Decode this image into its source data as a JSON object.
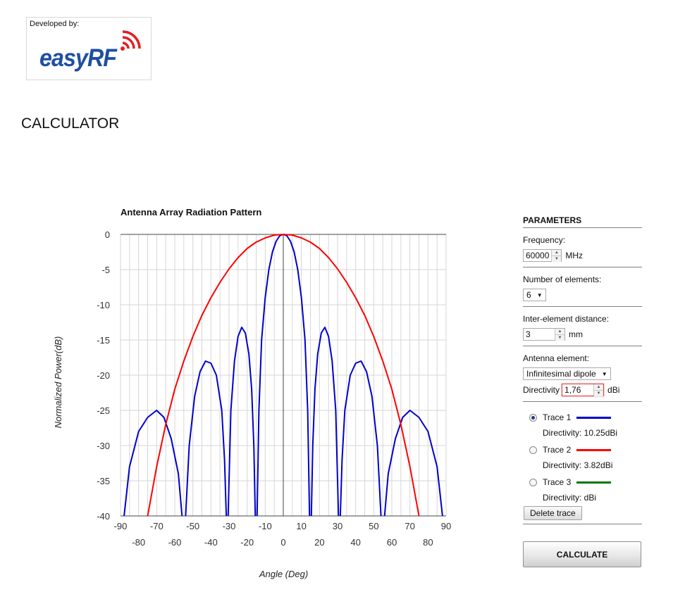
{
  "logo": {
    "developed_by": "Developed by:",
    "brand_easy": "easy",
    "brand_rf": "RF"
  },
  "page_title": "CALCULATOR",
  "chart_data": {
    "type": "line",
    "title": "Antenna Array Radiation Pattern",
    "xlabel": "Angle (Deg)",
    "ylabel": "Normalized Power(dB)",
    "xlim": [
      -90,
      90
    ],
    "ylim": [
      -40,
      0
    ],
    "yticks": [
      0,
      -5,
      -10,
      -15,
      -20,
      -25,
      -30,
      -35,
      -40
    ],
    "xticks_top": [
      -90,
      -70,
      -50,
      -30,
      -10,
      10,
      30,
      50,
      70,
      90
    ],
    "xticks_bottom": [
      -80,
      -60,
      -40,
      -20,
      0,
      20,
      40,
      60,
      80
    ],
    "grid": true,
    "series": [
      {
        "color": "#0000cc",
        "points": [
          [
            -88,
            -40
          ],
          [
            -85,
            -33
          ],
          [
            -80,
            -28
          ],
          [
            -75,
            -26
          ],
          [
            -70,
            -25
          ],
          [
            -66,
            -26
          ],
          [
            -62,
            -29
          ],
          [
            -58,
            -34
          ],
          [
            -56,
            -40
          ],
          [
            -54,
            -40
          ],
          [
            -52,
            -30
          ],
          [
            -49,
            -23
          ],
          [
            -46,
            -19.5
          ],
          [
            -43,
            -18
          ],
          [
            -40,
            -18.3
          ],
          [
            -37,
            -20
          ],
          [
            -34,
            -25
          ],
          [
            -32.5,
            -32
          ],
          [
            -31.5,
            -40
          ],
          [
            -30.5,
            -40
          ],
          [
            -29,
            -25
          ],
          [
            -27,
            -18
          ],
          [
            -25,
            -14.5
          ],
          [
            -23,
            -13.2
          ],
          [
            -21,
            -14
          ],
          [
            -19,
            -17
          ],
          [
            -17.5,
            -22
          ],
          [
            -16.3,
            -30
          ],
          [
            -15.5,
            -40
          ],
          [
            -14.5,
            -40
          ],
          [
            -13.5,
            -25
          ],
          [
            -12,
            -15
          ],
          [
            -10,
            -9
          ],
          [
            -8,
            -5
          ],
          [
            -6,
            -2.5
          ],
          [
            -4,
            -1
          ],
          [
            -2,
            -0.2
          ],
          [
            0,
            0
          ],
          [
            2,
            -0.2
          ],
          [
            4,
            -1
          ],
          [
            6,
            -2.5
          ],
          [
            8,
            -5
          ],
          [
            10,
            -9
          ],
          [
            12,
            -15
          ],
          [
            13.5,
            -25
          ],
          [
            14.5,
            -40
          ],
          [
            15.5,
            -40
          ],
          [
            16.3,
            -30
          ],
          [
            17.5,
            -22
          ],
          [
            19,
            -17
          ],
          [
            21,
            -14
          ],
          [
            23,
            -13.2
          ],
          [
            25,
            -14.5
          ],
          [
            27,
            -18
          ],
          [
            29,
            -25
          ],
          [
            30.5,
            -40
          ],
          [
            31.5,
            -40
          ],
          [
            32.5,
            -32
          ],
          [
            34,
            -25
          ],
          [
            37,
            -20
          ],
          [
            40,
            -18.3
          ],
          [
            43,
            -18
          ],
          [
            46,
            -19.5
          ],
          [
            49,
            -23
          ],
          [
            52,
            -30
          ],
          [
            54,
            -40
          ],
          [
            56,
            -40
          ],
          [
            58,
            -34
          ],
          [
            62,
            -29
          ],
          [
            66,
            -26
          ],
          [
            70,
            -25
          ],
          [
            75,
            -26
          ],
          [
            80,
            -28
          ],
          [
            85,
            -33
          ],
          [
            88,
            -40
          ]
        ]
      },
      {
        "color": "#ff0000",
        "points": [
          [
            -75,
            -40
          ],
          [
            -70,
            -33
          ],
          [
            -65,
            -27
          ],
          [
            -60,
            -22
          ],
          [
            -55,
            -18
          ],
          [
            -50,
            -14.5
          ],
          [
            -45,
            -11.5
          ],
          [
            -40,
            -9
          ],
          [
            -35,
            -6.8
          ],
          [
            -30,
            -4.9
          ],
          [
            -25,
            -3.3
          ],
          [
            -20,
            -2
          ],
          [
            -15,
            -1.1
          ],
          [
            -10,
            -0.5
          ],
          [
            -5,
            -0.1
          ],
          [
            0,
            0
          ],
          [
            5,
            -0.1
          ],
          [
            10,
            -0.5
          ],
          [
            15,
            -1.1
          ],
          [
            20,
            -2
          ],
          [
            25,
            -3.3
          ],
          [
            30,
            -4.9
          ],
          [
            35,
            -6.8
          ],
          [
            40,
            -9
          ],
          [
            45,
            -11.5
          ],
          [
            50,
            -14.5
          ],
          [
            55,
            -18
          ],
          [
            60,
            -22
          ],
          [
            65,
            -27
          ],
          [
            70,
            -33
          ],
          [
            75,
            -40
          ]
        ]
      }
    ]
  },
  "params": {
    "title": "PARAMETERS",
    "frequency_label": "Frequency:",
    "frequency_value": "60000",
    "frequency_unit": "MHz",
    "elements_label": "Number of elements:",
    "elements_value": "6",
    "distance_label": "Inter-element distance:",
    "distance_value": "3",
    "distance_unit": "mm",
    "element_label": "Antenna element:",
    "element_value": "Infinitesimal dipole",
    "directivity_label": "Directivity",
    "directivity_value": "1,76",
    "directivity_unit": "dBi",
    "traces": [
      {
        "label": "Trace 1",
        "color": "#0000cc",
        "selected": true,
        "directivity": "Directivity: 10.25dBi"
      },
      {
        "label": "Trace 2",
        "color": "#ff0000",
        "selected": false,
        "directivity": "Directivity: 3.82dBi"
      },
      {
        "label": "Trace 3",
        "color": "#007700",
        "selected": false,
        "directivity": "Directivity: dBi"
      }
    ],
    "delete_label": "Delete trace",
    "calculate_label": "CALCULATE"
  }
}
